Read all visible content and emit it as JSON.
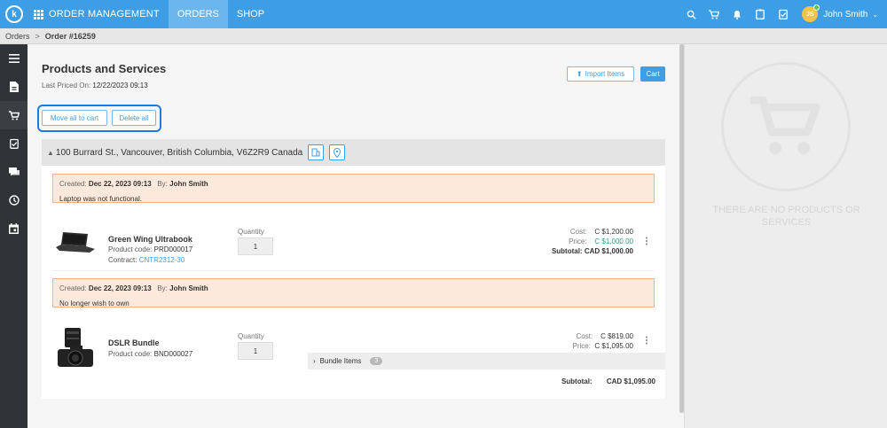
{
  "topbar": {
    "logo": "k",
    "app_title": "ORDER MANAGEMENT",
    "tabs": [
      {
        "label": "ORDERS",
        "active": true
      },
      {
        "label": "SHOP",
        "active": false
      }
    ],
    "icons": [
      "search-icon",
      "cart-icon",
      "bell-icon",
      "clipboard-icon",
      "checklist-icon"
    ],
    "user": {
      "initials": "JS",
      "name": "John Smith"
    }
  },
  "breadcrumb": {
    "root": "Orders",
    "separator": ">",
    "current": "Order #16259"
  },
  "sidebar": {
    "items": [
      "menu-icon",
      "document-icon",
      "cart-icon",
      "clipboard-icon",
      "chat-icon",
      "clock-icon",
      "calendar-icon"
    ]
  },
  "main": {
    "title": "Products and Services",
    "last_priced_label": "Last Priced On:",
    "last_priced_value": "12/22/2023 09:13",
    "import_label": "Import Items",
    "cart_label": "Cart",
    "move_all_label": "Move all to cart",
    "delete_all_label": "Delete all",
    "address": "100 Burrard St., Vancouver, British Columbia, V6Z2R9 Canada",
    "notes": [
      {
        "created_label": "Created:",
        "created": "Dec 22, 2023 09:13",
        "by_label": "By:",
        "by": "John Smith",
        "message": "Laptop was not functional."
      },
      {
        "created_label": "Created:",
        "created": "Dec 22, 2023 09:13",
        "by_label": "By:",
        "by": "John Smith",
        "message": "No longer wish to own"
      }
    ],
    "products": [
      {
        "name": "Green Wing Ultrabook",
        "code_label": "Product code:",
        "code": "PRD000017",
        "contract_label": "Contract:",
        "contract": "CNTR2312-30",
        "qty_label": "Quantity",
        "qty": "1",
        "cost_label": "Cost:",
        "cost": "C $1,200.00",
        "price_label": "Price:",
        "price": "C $1,000.00",
        "subtotal_label": "Subtotal:",
        "subtotal": "CAD $1,000.00"
      },
      {
        "name": "DSLR Bundle",
        "code_label": "Product code:",
        "code": "BND000027",
        "qty_label": "Quantity",
        "qty": "1",
        "cost_label": "Cost:",
        "cost": "C $819.00",
        "price_label": "Price:",
        "price": "C $1,095.00",
        "bundle_label": "Bundle Items",
        "bundle_count": "3",
        "subtotal_label": "Subtotal:",
        "subtotal": "CAD $1,095.00"
      }
    ]
  },
  "right_panel": {
    "empty_text": "THERE ARE NO PRODUCTS OR SERVICES"
  },
  "colors": {
    "accent": "#3d9ee6",
    "note_bg": "#fde9dc",
    "note_border": "#f1b28c",
    "price_green": "#2aa57c"
  }
}
